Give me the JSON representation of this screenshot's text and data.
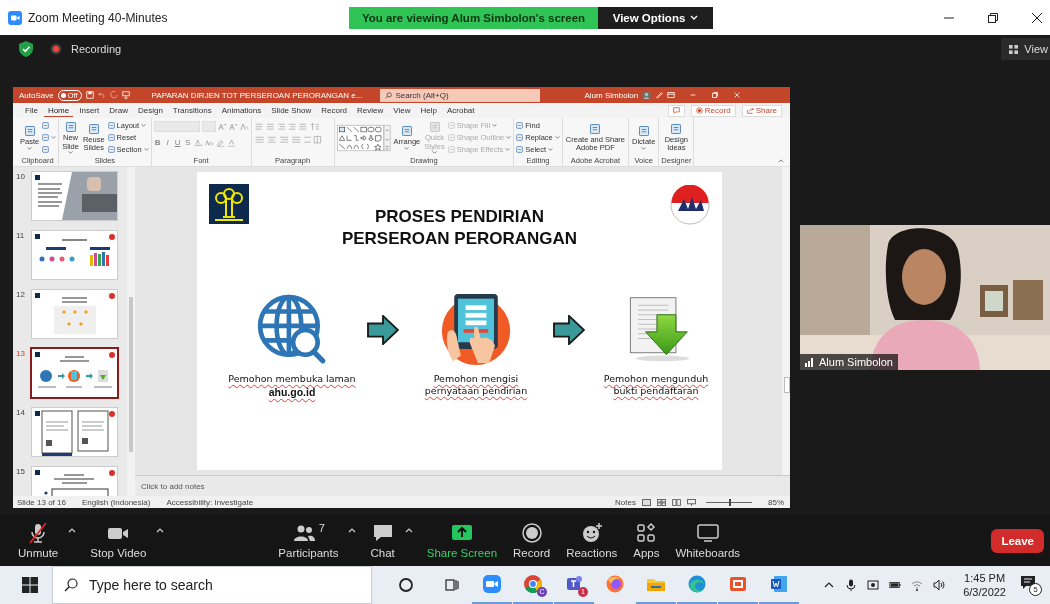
{
  "window": {
    "title": "Zoom Meeting 40-Minutes"
  },
  "share_banner": {
    "text": "You are viewing Alum Simbolon's screen",
    "view_options": "View Options"
  },
  "meeting_bar": {
    "recording": "Recording",
    "view": "View"
  },
  "powerpoint": {
    "autosave": {
      "label": "AutoSave",
      "state": "Off",
      "on": false
    },
    "document_title": "PAPARAN DIRJEN TOT PERSEROAN PERORANGAN e...",
    "search": {
      "placeholder": "Search (Alt+Q)"
    },
    "user": "Alum Simbolon",
    "tabs": [
      {
        "label": "File",
        "selected": false
      },
      {
        "label": "Home",
        "selected": true
      },
      {
        "label": "Insert",
        "selected": false
      },
      {
        "label": "Draw",
        "selected": false
      },
      {
        "label": "Design",
        "selected": false
      },
      {
        "label": "Transitions",
        "selected": false
      },
      {
        "label": "Animations",
        "selected": false
      },
      {
        "label": "Slide Show",
        "selected": false
      },
      {
        "label": "Record",
        "selected": false
      },
      {
        "label": "Review",
        "selected": false
      },
      {
        "label": "View",
        "selected": false
      },
      {
        "label": "Help",
        "selected": false
      },
      {
        "label": "Acrobat",
        "selected": false
      }
    ],
    "record_button": "Record",
    "share_button": "Share",
    "ribbon_groups": [
      {
        "label": "Clipboard",
        "kind": "commands",
        "columns": [
          [
            {
              "kind": "large",
              "lines": [
                "Paste"
              ],
              "dropdown": true,
              "disabled": false
            }
          ],
          [
            {
              "kind": "small",
              "dropdown": false,
              "disabled": false
            },
            {
              "kind": "small",
              "dropdown": true,
              "disabled": false
            },
            {
              "kind": "small",
              "dropdown": false,
              "disabled": false
            }
          ]
        ]
      },
      {
        "label": "Slides",
        "kind": "commands",
        "columns": [
          [
            {
              "kind": "large",
              "lines": [
                "New",
                "Slide"
              ],
              "dropdown": true,
              "disabled": false
            }
          ],
          [
            {
              "kind": "large",
              "lines": [
                "Reuse",
                "Slides"
              ],
              "dropdown": false,
              "disabled": false
            }
          ],
          [
            {
              "kind": "small",
              "label": "Layout",
              "dropdown": true,
              "disabled": false
            },
            {
              "kind": "small",
              "label": "Reset",
              "dropdown": false,
              "disabled": false
            },
            {
              "kind": "small",
              "label": "Section",
              "dropdown": true,
              "disabled": false
            }
          ]
        ]
      },
      {
        "label": "Font",
        "kind": "font",
        "glyphs": [
          "B",
          "I",
          "U",
          "S"
        ]
      },
      {
        "label": "Paragraph",
        "kind": "paragraph"
      },
      {
        "label": "Drawing",
        "kind": "commands",
        "columns": [
          [
            {
              "kind": "gallery",
              "disabled": false
            }
          ],
          [
            {
              "kind": "large",
              "lines": [
                "Arrange"
              ],
              "dropdown": true,
              "disabled": false
            }
          ],
          [
            {
              "kind": "large",
              "lines": [
                "Quick",
                "Styles"
              ],
              "dropdown": true,
              "disabled": true
            }
          ],
          [
            {
              "kind": "small",
              "label": "Shape Fill",
              "dropdown": true,
              "disabled": true
            },
            {
              "kind": "small",
              "label": "Shape Outline",
              "dropdown": true,
              "disabled": true
            },
            {
              "kind": "small",
              "label": "Shape Effects",
              "dropdown": true,
              "disabled": true
            }
          ]
        ]
      },
      {
        "label": "Editing",
        "kind": "commands",
        "columns": [
          [
            {
              "kind": "small",
              "label": "Find",
              "dropdown": false,
              "disabled": false
            },
            {
              "kind": "small",
              "label": "Replace",
              "dropdown": true,
              "disabled": false
            },
            {
              "kind": "small",
              "label": "Select",
              "dropdown": true,
              "disabled": false
            }
          ]
        ]
      },
      {
        "label": "Adobe Acrobat",
        "kind": "commands",
        "columns": [
          [
            {
              "kind": "large",
              "lines": [
                "Create and Share",
                "Adobe PDF"
              ],
              "dropdown": false,
              "disabled": false
            }
          ]
        ]
      },
      {
        "label": "Voice",
        "kind": "commands",
        "columns": [
          [
            {
              "kind": "large",
              "lines": [
                "Dictate"
              ],
              "dropdown": true,
              "disabled": false
            }
          ]
        ]
      },
      {
        "label": "Designer",
        "kind": "commands",
        "columns": [
          [
            {
              "kind": "large",
              "lines": [
                "Design",
                "Ideas"
              ],
              "dropdown": false,
              "disabled": false
            }
          ]
        ]
      }
    ],
    "thumbnails": [
      {
        "number": "10",
        "selected": false
      },
      {
        "number": "11",
        "kind": "people",
        "selected": false
      },
      {
        "number": "12",
        "kind": "diamonds",
        "selected": false
      },
      {
        "number": "13",
        "kind": "process",
        "selected": true
      },
      {
        "number": "14",
        "kind": "certificates",
        "selected": false
      },
      {
        "number": "15",
        "kind": "bullets",
        "selected": false
      }
    ],
    "slide": {
      "title_lines": [
        "PROSES PENDIRIAN",
        "PERSEROAN PERORANGAN"
      ],
      "steps": [
        {
          "kind": "globe",
          "lines": [
            {
              "text": "Pemohon membuka laman",
              "emphasis": false,
              "misspelled": true
            },
            {
              "text": "ahu.go.id",
              "emphasis": true,
              "misspelled": true
            }
          ]
        },
        {
          "kind": "tablet",
          "lines": [
            {
              "text": "Pemohon mengisi",
              "emphasis": false,
              "misspelled": true
            },
            {
              "text": "pernyataan pendirian",
              "emphasis": false,
              "misspelled": true
            }
          ]
        },
        {
          "kind": "download",
          "lines": [
            {
              "text": "Pemohon mengunduh",
              "emphasis": false,
              "misspelled": true
            },
            {
              "text": "bukti pendaftaran",
              "emphasis": false,
              "misspelled": true
            }
          ]
        }
      ]
    },
    "notes": {
      "placeholder": "Click to add notes"
    },
    "status_bar": {
      "slide": "Slide 13 of 16",
      "language": "English (Indonesia)",
      "accessibility": "Accessibility: Investigate",
      "notes": "Notes",
      "zoom": "85%",
      "level": 0.5
    }
  },
  "video": {
    "name": "Alum Simbolon"
  },
  "toolbar": {
    "buttons": [
      {
        "label": "Unmute",
        "kind": "mic",
        "muted": true,
        "caret": true
      },
      {
        "label": "Stop Video",
        "kind": "camera",
        "muted": false,
        "caret": true
      },
      {
        "label": "Participants",
        "kind": "people",
        "count": "7",
        "muted": false,
        "caret": true
      },
      {
        "label": "Chat",
        "kind": "chat",
        "muted": false,
        "caret": true
      },
      {
        "label": "Share Screen",
        "kind": "share",
        "muted": false,
        "caret": false
      },
      {
        "label": "Record",
        "kind": "record",
        "muted": false,
        "caret": false
      },
      {
        "label": "Reactions",
        "kind": "reactions",
        "muted": false,
        "caret": false
      },
      {
        "label": "Apps",
        "kind": "apps",
        "muted": false,
        "caret": false
      },
      {
        "label": "Whiteboards",
        "kind": "whiteboard",
        "muted": false,
        "caret": false
      }
    ],
    "leave": "Leave"
  },
  "taskbar": {
    "search": {
      "placeholder": "Type here to search"
    },
    "apps": [
      {
        "kind": "zoom",
        "running": true
      },
      {
        "kind": "chrome",
        "badge": "C",
        "running": true
      },
      {
        "kind": "teams",
        "badge": "1",
        "running": true
      },
      {
        "kind": "firefox",
        "running": false
      },
      {
        "kind": "folder",
        "running": true
      },
      {
        "kind": "edge",
        "running": true
      },
      {
        "kind": "orange",
        "running": true
      },
      {
        "kind": "word",
        "running": true
      }
    ],
    "time": "1:45 PM",
    "date": "6/3/2022",
    "notifications": "5"
  }
}
